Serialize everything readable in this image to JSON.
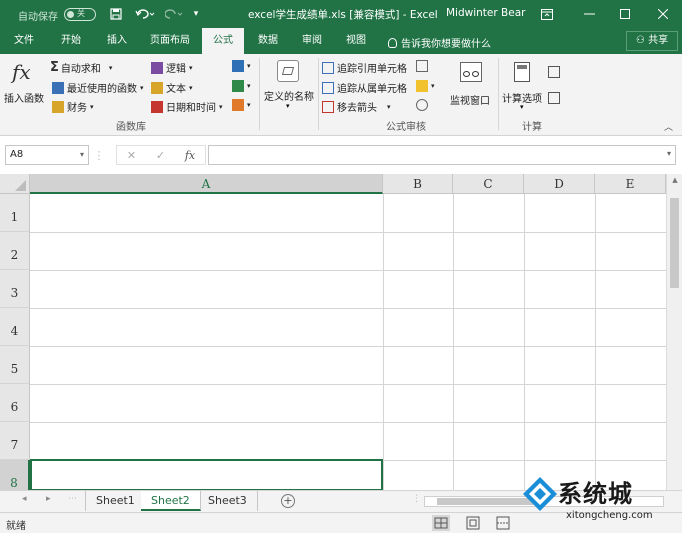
{
  "titlebar": {
    "autosave_label": "自动保存",
    "autosave_state": "关",
    "doc_title": "excel学生成绩单.xls  [兼容模式]  -  Excel",
    "user_name": "Midwinter Bear"
  },
  "tabs": [
    "文件",
    "开始",
    "插入",
    "页面布局",
    "公式",
    "数据",
    "审阅",
    "视图"
  ],
  "tell_me": "告诉我你想要做什么",
  "share_label": "共享",
  "ribbon": {
    "insert_function": "插入函数",
    "fx_symbol": "fx",
    "autosum": "自动求和",
    "recent": "最近使用的函数",
    "financial": "财务",
    "logical": "逻辑",
    "text": "文本",
    "datetime": "日期和时间",
    "group_library": "函数库",
    "define_name": "定义的名称",
    "trace_precedents": "追踪引用单元格",
    "trace_dependents": "追踪从属单元格",
    "remove_arrows": "移去箭头",
    "watch_window": "监视窗口",
    "group_audit": "公式审核",
    "calc_options": "计算选项",
    "group_calc": "计算"
  },
  "formula_bar": {
    "name_box": "A8",
    "cancel_symbol": "✕",
    "enter_symbol": "✓",
    "fx_symbol": "fx",
    "formula": ""
  },
  "columns": [
    "A",
    "B",
    "C",
    "D",
    "E"
  ],
  "rows": [
    "1",
    "2",
    "3",
    "4",
    "5",
    "6",
    "7",
    "8"
  ],
  "selected_cell": "A8",
  "sheets": [
    "Sheet1",
    "Sheet2",
    "Sheet3"
  ],
  "active_sheet": "Sheet2",
  "status": "就绪",
  "watermark": {
    "text": "系统城",
    "url": "xitongcheng.com"
  },
  "colors": {
    "accent": "#217346",
    "ribbon_bg": "#f3f3f3"
  }
}
